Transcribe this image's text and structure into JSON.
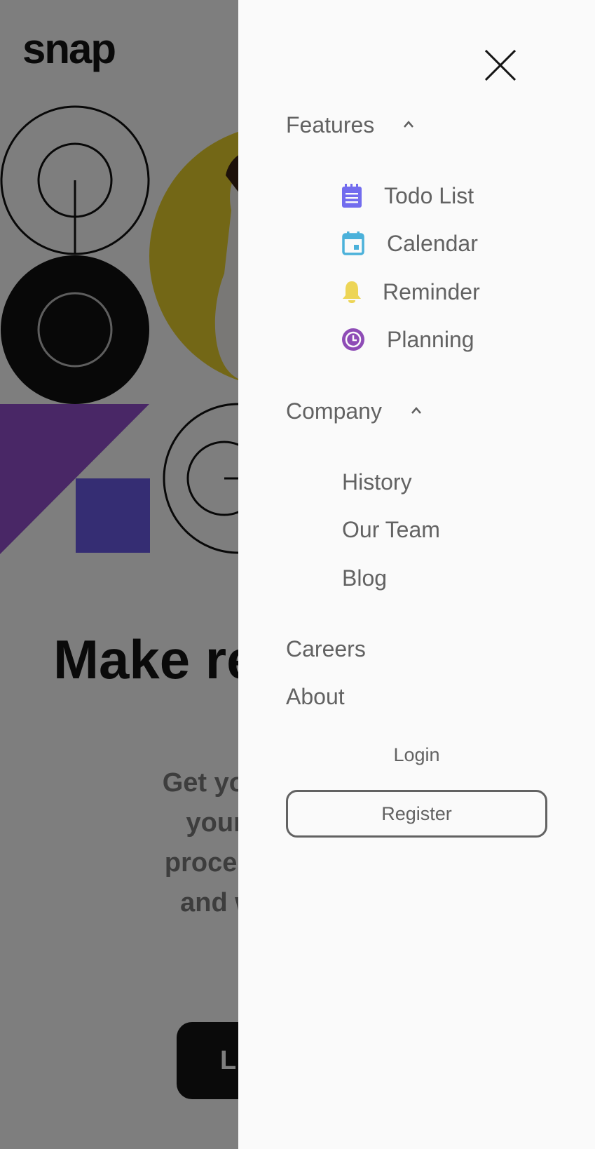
{
  "brand": {
    "logo": "snap"
  },
  "hero": {
    "headline": "Make re",
    "subtext_lines": [
      "Get your tear",
      "your loca",
      "processes, c",
      "and watch"
    ],
    "cta_label": "L",
    "colors": {
      "yellow": "#f0df3a",
      "purple": "#8d45c9",
      "indigo": "#6b5be6",
      "black": "#111111"
    }
  },
  "drawer": {
    "close_label": "Close menu",
    "sections": [
      {
        "label": "Features",
        "expanded": true,
        "items": [
          {
            "label": "Todo List",
            "icon": "todo-list-icon",
            "color": "#726cee"
          },
          {
            "label": "Calendar",
            "icon": "calendar-icon",
            "color": "#4bb1da"
          },
          {
            "label": "Reminder",
            "icon": "reminder-bell-icon",
            "color": "#edd556"
          },
          {
            "label": "Planning",
            "icon": "planning-clock-icon",
            "color": "#8e4cb6"
          }
        ]
      },
      {
        "label": "Company",
        "expanded": true,
        "items": [
          {
            "label": "History"
          },
          {
            "label": "Our Team"
          },
          {
            "label": "Blog"
          }
        ]
      }
    ],
    "links": [
      "Careers",
      "About"
    ],
    "login": "Login",
    "register": "Register"
  }
}
